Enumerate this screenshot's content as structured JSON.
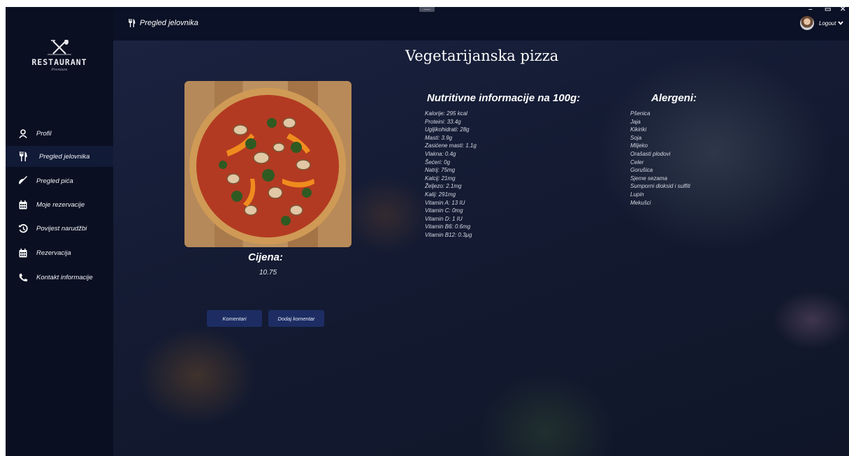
{
  "header": {
    "title": "Pregled jelovnika",
    "logout_label": "Logout",
    "window_controls": [
      "–",
      "▭",
      "✕"
    ]
  },
  "logo": {
    "title": "RESTAURANT",
    "subtitle": "Premium"
  },
  "sidebar": {
    "items": [
      {
        "label": "Profil",
        "icon": "user-icon",
        "active": false
      },
      {
        "label": "Pregled jelovnika",
        "icon": "fork-knife-icon",
        "active": true
      },
      {
        "label": "Pregled pića",
        "icon": "drink-icon",
        "active": false
      },
      {
        "label": "Moje rezervacije",
        "icon": "calendar-icon",
        "active": false
      },
      {
        "label": "Povijest narudžbi",
        "icon": "history-icon",
        "active": false
      },
      {
        "label": "Rezervacija",
        "icon": "calendar-icon",
        "active": false
      },
      {
        "label": "Kontakt informacije",
        "icon": "phone-icon",
        "active": false
      }
    ]
  },
  "dish": {
    "name": "Vegetarijanska pizza",
    "price_label": "Cijena:",
    "price": "10.75"
  },
  "buttons": {
    "comments": "Komentari",
    "add_comment": "Dodaj komentar"
  },
  "nutrition": {
    "title": "Nutritivne informacije na 100g:",
    "items": [
      "Kalorije: 295 kcal",
      "Proteini: 33.4g",
      "Ugljikohidrati: 28g",
      "Masti: 3.9g",
      "Zasićene masti: 1.1g",
      "Vlakna: 0.4g",
      "Šećeri: 0g",
      "Natrij: 75mg",
      "Kalcij: 21mg",
      "Željezo: 2.1mg",
      "Kalij: 291mg",
      "Vitamin A: 13 IU",
      "Vitamin C: 0mg",
      "Vitamin D: 1 IU",
      "Vitamin B6: 0.6mg",
      "Vitamin B12: 0.3μg"
    ]
  },
  "allergens": {
    "title": "Alergeni:",
    "items": [
      "Pšenica",
      "Jaja",
      "Kikiriki",
      "Soja",
      "Mlijeko",
      "Orašasti plodovi",
      "Celer",
      "Gorušica",
      "Sjeme sezama",
      "Sumporni dioksid i sulfiti",
      "Lupin",
      "Mekušci"
    ]
  },
  "colors": {
    "sidebar_bg": "#0a0f22",
    "header_bg": "#0b1126",
    "button_bg": "#1d2d63",
    "text": "#ffffff"
  }
}
